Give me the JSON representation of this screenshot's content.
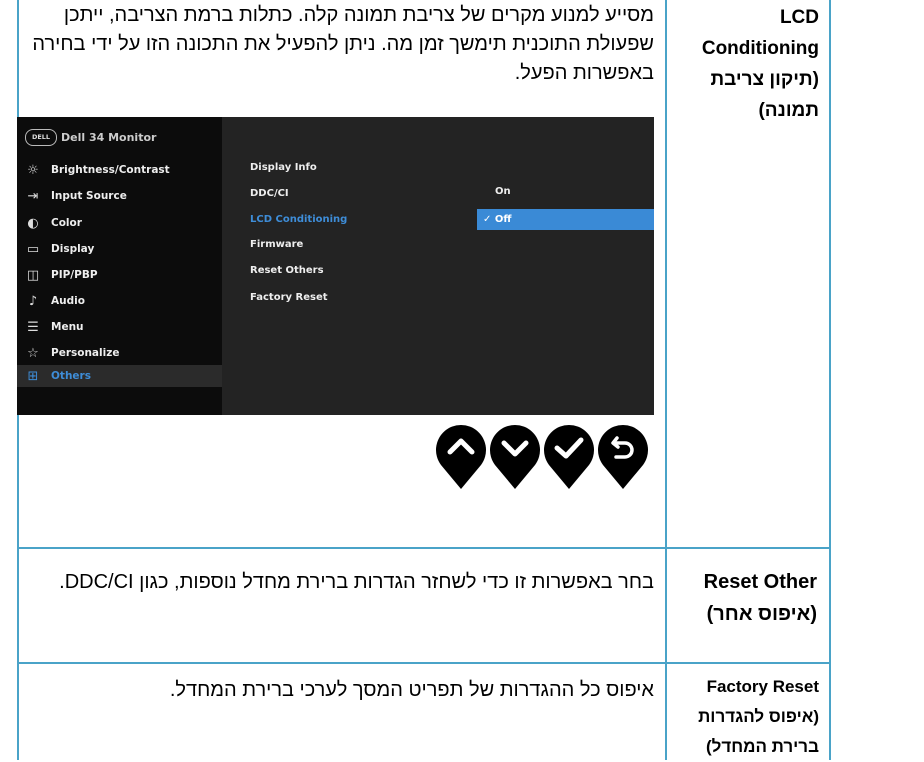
{
  "rows": [
    {
      "head": "LCD Conditioning (תיקון צריבת תמונה)",
      "body": "מסייע למנוע מקרים של צריבת תמונה קלה. כתלות ברמת הצריבה, ייתכן שפעולת התוכנית תימשך זמן מה. ניתן להפעיל את התכונה הזו על ידי בחירה באפשרות הפעל."
    },
    {
      "head": "Reset Other (איפוס אחר)",
      "body": "בחר באפשרות זו כדי לשחזר הגדרות ברירת מחדל נוספות, כגון DDC/CI."
    },
    {
      "head": "Factory Reset (איפוס להגדרות ברירת המחדל)",
      "body": "איפוס כל ההגדרות של תפריט המסך לערכי ברירת המחדל."
    }
  ],
  "osd": {
    "logo": "DELL",
    "title": "Dell 34 Monitor",
    "menu": [
      {
        "icon": "brightness-icon",
        "glyph": "☼",
        "label": "Brightness/Contrast"
      },
      {
        "icon": "input-source-icon",
        "glyph": "⇥",
        "label": "Input Source"
      },
      {
        "icon": "color-icon",
        "glyph": "◐",
        "label": "Color"
      },
      {
        "icon": "display-icon",
        "glyph": "▭",
        "label": "Display"
      },
      {
        "icon": "pip-pbp-icon",
        "glyph": "◫",
        "label": "PIP/PBP"
      },
      {
        "icon": "audio-icon",
        "glyph": "♪",
        "label": "Audio"
      },
      {
        "icon": "menu-icon",
        "glyph": "☰",
        "label": "Menu"
      },
      {
        "icon": "star-icon",
        "glyph": "☆",
        "label": "Personalize"
      },
      {
        "icon": "others-icon",
        "glyph": "⊞",
        "label": "Others",
        "active": true
      }
    ],
    "submenu": [
      "Display Info",
      "DDC/CI",
      "LCD Conditioning",
      "Firmware",
      "Reset Others",
      "Factory Reset"
    ],
    "submenu_active": "LCD Conditioning",
    "option_on": "On",
    "option_off": "✓ Off",
    "colors": {
      "accent": "#3a8ad6",
      "panel": "#232323",
      "sidebar": "#0c0c0c"
    }
  },
  "buttons": [
    {
      "icon": "chevron-up-icon"
    },
    {
      "icon": "chevron-down-icon"
    },
    {
      "icon": "check-icon"
    },
    {
      "icon": "back-icon"
    }
  ],
  "colors": {
    "grid": "#4aa3c8"
  }
}
